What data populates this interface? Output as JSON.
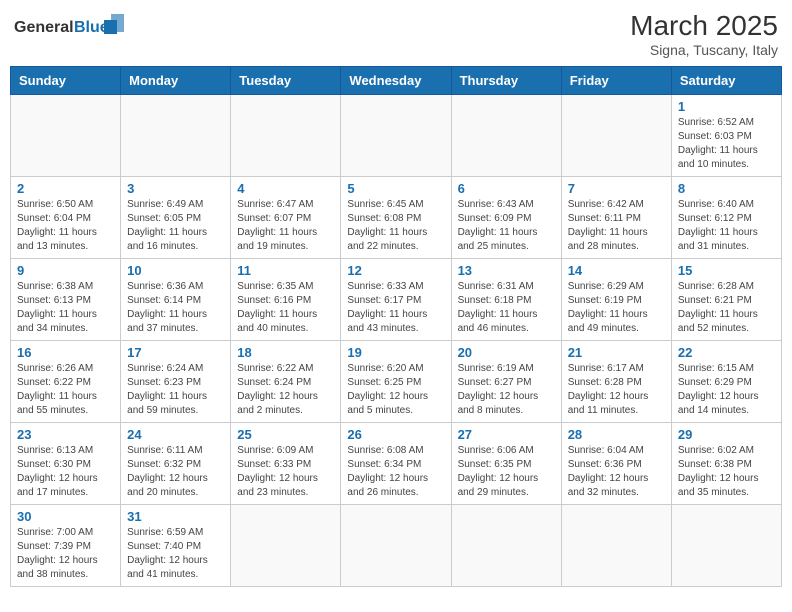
{
  "logo": {
    "text_general": "General",
    "text_blue": "Blue"
  },
  "header": {
    "month_year": "March 2025",
    "location": "Signa, Tuscany, Italy"
  },
  "weekdays": [
    "Sunday",
    "Monday",
    "Tuesday",
    "Wednesday",
    "Thursday",
    "Friday",
    "Saturday"
  ],
  "days": {
    "d1": {
      "n": "1",
      "sr": "6:52 AM",
      "ss": "6:03 PM",
      "dl": "11 hours and 10 minutes."
    },
    "d2": {
      "n": "2",
      "sr": "6:50 AM",
      "ss": "6:04 PM",
      "dl": "11 hours and 13 minutes."
    },
    "d3": {
      "n": "3",
      "sr": "6:49 AM",
      "ss": "6:05 PM",
      "dl": "11 hours and 16 minutes."
    },
    "d4": {
      "n": "4",
      "sr": "6:47 AM",
      "ss": "6:07 PM",
      "dl": "11 hours and 19 minutes."
    },
    "d5": {
      "n": "5",
      "sr": "6:45 AM",
      "ss": "6:08 PM",
      "dl": "11 hours and 22 minutes."
    },
    "d6": {
      "n": "6",
      "sr": "6:43 AM",
      "ss": "6:09 PM",
      "dl": "11 hours and 25 minutes."
    },
    "d7": {
      "n": "7",
      "sr": "6:42 AM",
      "ss": "6:11 PM",
      "dl": "11 hours and 28 minutes."
    },
    "d8": {
      "n": "8",
      "sr": "6:40 AM",
      "ss": "6:12 PM",
      "dl": "11 hours and 31 minutes."
    },
    "d9": {
      "n": "9",
      "sr": "6:38 AM",
      "ss": "6:13 PM",
      "dl": "11 hours and 34 minutes."
    },
    "d10": {
      "n": "10",
      "sr": "6:36 AM",
      "ss": "6:14 PM",
      "dl": "11 hours and 37 minutes."
    },
    "d11": {
      "n": "11",
      "sr": "6:35 AM",
      "ss": "6:16 PM",
      "dl": "11 hours and 40 minutes."
    },
    "d12": {
      "n": "12",
      "sr": "6:33 AM",
      "ss": "6:17 PM",
      "dl": "11 hours and 43 minutes."
    },
    "d13": {
      "n": "13",
      "sr": "6:31 AM",
      "ss": "6:18 PM",
      "dl": "11 hours and 46 minutes."
    },
    "d14": {
      "n": "14",
      "sr": "6:29 AM",
      "ss": "6:19 PM",
      "dl": "11 hours and 49 minutes."
    },
    "d15": {
      "n": "15",
      "sr": "6:28 AM",
      "ss": "6:21 PM",
      "dl": "11 hours and 52 minutes."
    },
    "d16": {
      "n": "16",
      "sr": "6:26 AM",
      "ss": "6:22 PM",
      "dl": "11 hours and 55 minutes."
    },
    "d17": {
      "n": "17",
      "sr": "6:24 AM",
      "ss": "6:23 PM",
      "dl": "11 hours and 59 minutes."
    },
    "d18": {
      "n": "18",
      "sr": "6:22 AM",
      "ss": "6:24 PM",
      "dl": "12 hours and 2 minutes."
    },
    "d19": {
      "n": "19",
      "sr": "6:20 AM",
      "ss": "6:25 PM",
      "dl": "12 hours and 5 minutes."
    },
    "d20": {
      "n": "20",
      "sr": "6:19 AM",
      "ss": "6:27 PM",
      "dl": "12 hours and 8 minutes."
    },
    "d21": {
      "n": "21",
      "sr": "6:17 AM",
      "ss": "6:28 PM",
      "dl": "12 hours and 11 minutes."
    },
    "d22": {
      "n": "22",
      "sr": "6:15 AM",
      "ss": "6:29 PM",
      "dl": "12 hours and 14 minutes."
    },
    "d23": {
      "n": "23",
      "sr": "6:13 AM",
      "ss": "6:30 PM",
      "dl": "12 hours and 17 minutes."
    },
    "d24": {
      "n": "24",
      "sr": "6:11 AM",
      "ss": "6:32 PM",
      "dl": "12 hours and 20 minutes."
    },
    "d25": {
      "n": "25",
      "sr": "6:09 AM",
      "ss": "6:33 PM",
      "dl": "12 hours and 23 minutes."
    },
    "d26": {
      "n": "26",
      "sr": "6:08 AM",
      "ss": "6:34 PM",
      "dl": "12 hours and 26 minutes."
    },
    "d27": {
      "n": "27",
      "sr": "6:06 AM",
      "ss": "6:35 PM",
      "dl": "12 hours and 29 minutes."
    },
    "d28": {
      "n": "28",
      "sr": "6:04 AM",
      "ss": "6:36 PM",
      "dl": "12 hours and 32 minutes."
    },
    "d29": {
      "n": "29",
      "sr": "6:02 AM",
      "ss": "6:38 PM",
      "dl": "12 hours and 35 minutes."
    },
    "d30": {
      "n": "30",
      "sr": "7:00 AM",
      "ss": "7:39 PM",
      "dl": "12 hours and 38 minutes."
    },
    "d31": {
      "n": "31",
      "sr": "6:59 AM",
      "ss": "7:40 PM",
      "dl": "12 hours and 41 minutes."
    }
  }
}
